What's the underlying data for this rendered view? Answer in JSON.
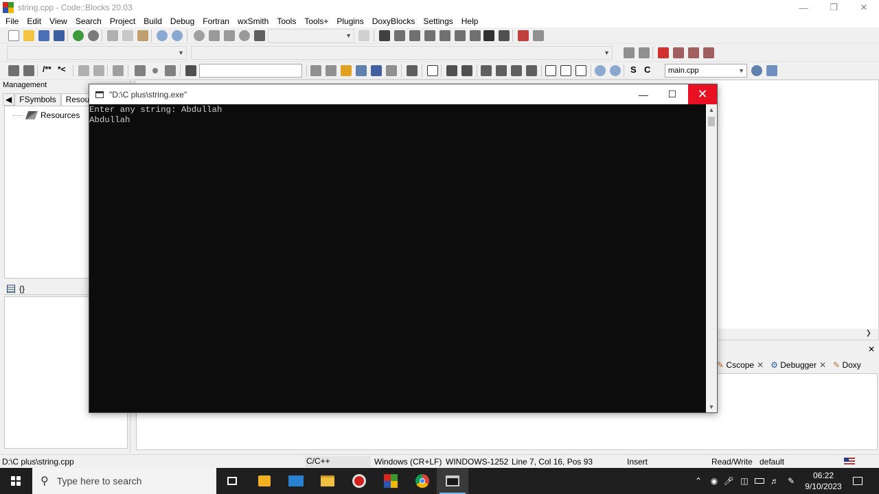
{
  "window": {
    "title": "string.cpp - Code::Blocks 20.03"
  },
  "menu": [
    "File",
    "Edit",
    "View",
    "Search",
    "Project",
    "Build",
    "Debug",
    "Fortran",
    "wxSmith",
    "Tools",
    "Tools+",
    "Plugins",
    "DoxyBlocks",
    "Settings",
    "Help"
  ],
  "toolbar": {
    "file_combo": "main.cpp",
    "search_combo": ""
  },
  "management": {
    "title": "Management",
    "tabs": [
      "FSymbols",
      "Resource"
    ],
    "tree_root": "Resources",
    "symbols_button": "{}"
  },
  "logs": {
    "tabs": [
      "Cscope",
      "Debugger",
      "Doxy"
    ]
  },
  "console": {
    "title": "\"D:\\C plus\\string.exe\"",
    "lines": [
      "Enter any string: Abdullah",
      "Abdullah"
    ]
  },
  "status": {
    "path": "D:\\C plus\\string.cpp",
    "language": "C/C++",
    "line_endings": "Windows (CR+LF)",
    "encoding": "WINDOWS-1252",
    "position": "Line 7, Col 16, Pos 93",
    "mode": "Insert",
    "access": "Read/Write",
    "profile": "default"
  },
  "taskbar": {
    "search_placeholder": "Type here to search",
    "time": "06:22",
    "date": "9/10/2023"
  },
  "colors": {
    "close_red": "#e81123",
    "console_bg": "#0c0c0c",
    "console_text": "#cccccc",
    "taskbar": "#1f1f1f"
  }
}
